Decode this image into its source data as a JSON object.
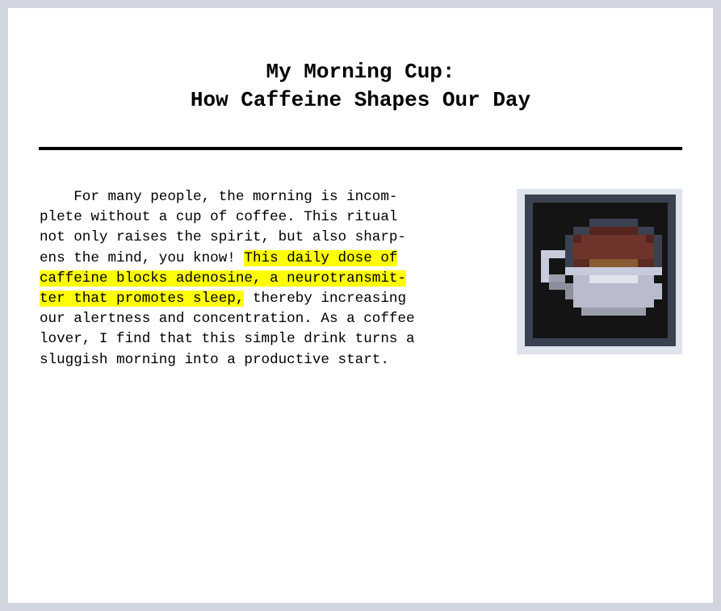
{
  "article": {
    "title_line1": "My Morning Cup:",
    "title_line2": "How Caffeine Shapes Our Day",
    "paragraph": {
      "lines": [
        [
          "    For many people, the morning is incom-"
        ],
        [
          "plete without a cup of coffee. This ritual"
        ],
        [
          "not only raises the spirit, but also sharp-"
        ],
        [
          "ens the mind, you know! ",
          "This daily dose of"
        ],
        [
          "",
          "caffeine blocks adenosine, a neurotransmit-"
        ],
        [
          "",
          "ter that promotes sleep,",
          " thereby increasing"
        ],
        [
          "our alertness and concentration. As a coffee"
        ],
        [
          "lover, I find that this simple drink turns a"
        ],
        [
          "sluggish morning into a productive start."
        ]
      ]
    },
    "highlight_color": "#ffff00",
    "image_icon": "coffee-cup-pixel-icon"
  }
}
